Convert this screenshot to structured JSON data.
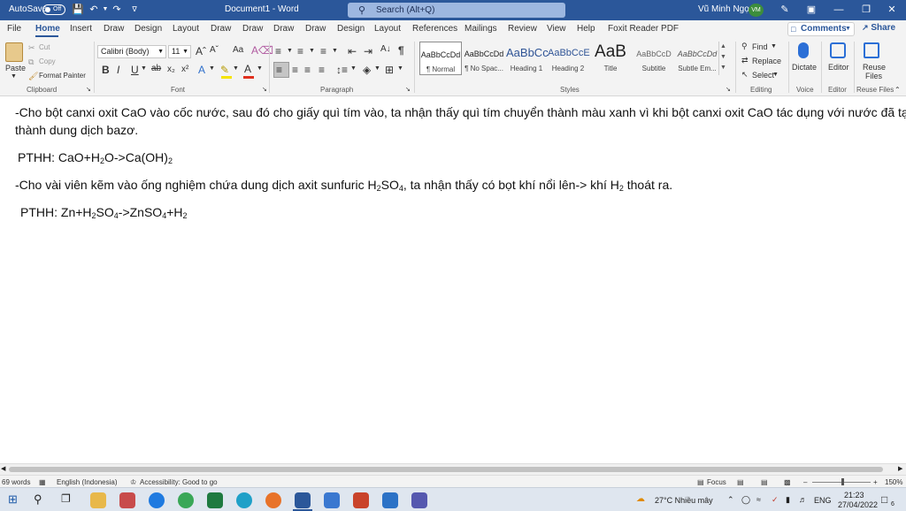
{
  "titlebar": {
    "autosave_label": "AutoSave",
    "autosave_state": "Off",
    "doc_title": "Document1 - Word",
    "search_placeholder": "Search (Alt+Q)",
    "user_name": "Vũ Minh Ngọc",
    "user_initials": "VM"
  },
  "menu": {
    "tabs": [
      "File",
      "Home",
      "Insert",
      "Draw",
      "Design",
      "Layout",
      "Draw",
      "Draw",
      "Draw",
      "Draw",
      "Design",
      "Layout",
      "References",
      "Mailings",
      "Review",
      "View",
      "Help",
      "Foxit Reader PDF"
    ],
    "active_tab": "Home",
    "comments_label": "Comments",
    "share_label": "Share"
  },
  "ribbon": {
    "clipboard": {
      "paste": "Paste",
      "cut": "Cut",
      "copy": "Copy",
      "format_painter": "Format Painter",
      "label": "Clipboard"
    },
    "font": {
      "font_name": "Calibri (Body)",
      "font_size": "11",
      "label": "Font"
    },
    "paragraph": {
      "label": "Paragraph"
    },
    "styles": {
      "items": [
        {
          "preview": "AaBbCcDd",
          "name": "¶ Normal"
        },
        {
          "preview": "AaBbCcDd",
          "name": "¶ No Spac..."
        },
        {
          "preview": "AaBbCc",
          "name": "Heading 1"
        },
        {
          "preview": "AaBbCcE",
          "name": "Heading 2"
        },
        {
          "preview": "AaB",
          "name": "Title"
        },
        {
          "preview": "AaBbCcD",
          "name": "Subtitle"
        },
        {
          "preview": "AaBbCcDd",
          "name": "Subtle Em..."
        }
      ],
      "label": "Styles"
    },
    "editing": {
      "find": "Find",
      "replace": "Replace",
      "select": "Select",
      "label": "Editing"
    },
    "voice": {
      "dictate": "Dictate",
      "label": "Voice"
    },
    "editor": {
      "editor": "Editor",
      "label": "Editor"
    },
    "reuse": {
      "line1": "Reuse",
      "line2": "Files",
      "label": "Reuse Files"
    }
  },
  "document": {
    "p1_line1": "-Cho bột canxi oxit CaO vào cốc nước, sau đó cho giấy quì tím vào, ta nhận thấy quì tím chuyển thành màu xanh vì khi bột canxi oxit CaO tác dụng với nước đã tạo",
    "p1_line2": "thành dung dịch bazơ.",
    "eq1": {
      "prefix": "PTHH: CaO+H",
      "s1": "2",
      "mid": "O->Ca(OH)",
      "s2": "2"
    },
    "p2": {
      "a": "-Cho vài viên kẽm vào ống nghiệm chứa dung dịch axit sunfuric H",
      "s1": "2",
      "b": "SO",
      "s2": "4",
      "c": ", ta nhận thấy có bọt khí nổi lên-> khí H",
      "s3": "2",
      "d": " thoát ra."
    },
    "eq2": {
      "a": "PTHH: Zn+H",
      "s1": "2",
      "b": "SO",
      "s2": "4",
      "c": "->ZnSO",
      "s3": "4",
      "d": "+H",
      "s4": "2"
    }
  },
  "status": {
    "words": "69 words",
    "language": "English (Indonesia)",
    "accessibility": "Accessibility: Good to go",
    "focus": "Focus",
    "zoom": "150%"
  },
  "taskbar": {
    "weather": "27°C Nhiều mây",
    "lang": "ENG",
    "time": "21:23",
    "date": "27/04/2022",
    "notif_count": "6"
  }
}
